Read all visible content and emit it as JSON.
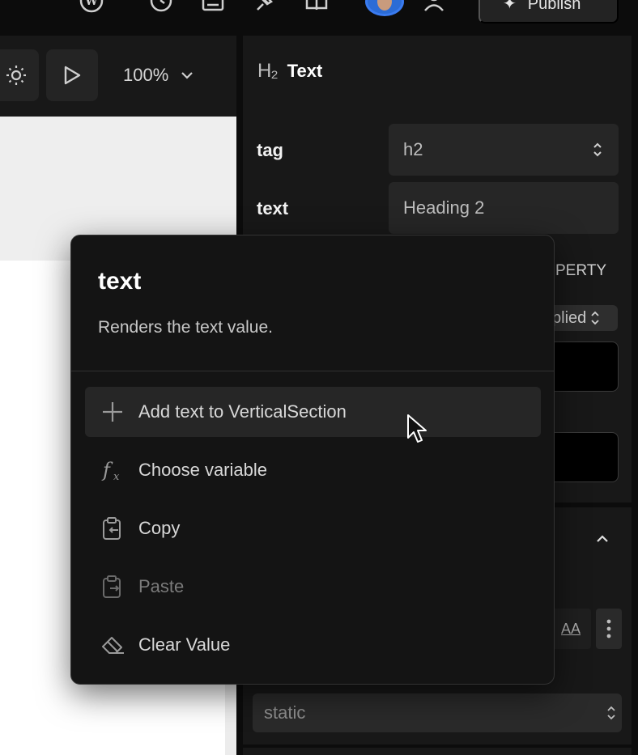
{
  "topbar": {
    "icons": [
      "wordpress-icon",
      "history-icon",
      "pages-icon",
      "pin-icon",
      "book-icon",
      "users-icon"
    ],
    "publish_label": "Publish"
  },
  "canvas_toolbar": {
    "zoom": "100%"
  },
  "panel": {
    "title": "Text",
    "tag_label": "tag",
    "tag_value": "h2",
    "text_label": "text",
    "text_value": "Heading 2",
    "partial_property": "PERTY",
    "partial_applied": "plied"
  },
  "style_section": {
    "position_value": "static"
  },
  "popup": {
    "title": "text",
    "description": "Renders the text value.",
    "items": [
      {
        "label": "Add text to VerticalSection",
        "icon": "plus-icon",
        "active": true,
        "disabled": false
      },
      {
        "label": "Choose variable",
        "icon": "function-icon",
        "active": false,
        "disabled": false
      },
      {
        "label": "Copy",
        "icon": "copy-icon",
        "active": false,
        "disabled": false
      },
      {
        "label": "Paste",
        "icon": "paste-icon",
        "active": false,
        "disabled": true
      },
      {
        "label": "Clear Value",
        "icon": "eraser-icon",
        "active": false,
        "disabled": false
      }
    ]
  },
  "colors": {
    "background": "#0c0c0c",
    "panel": "#181818",
    "popup": "#141414",
    "accent_avatar": "#2b6cd6"
  }
}
